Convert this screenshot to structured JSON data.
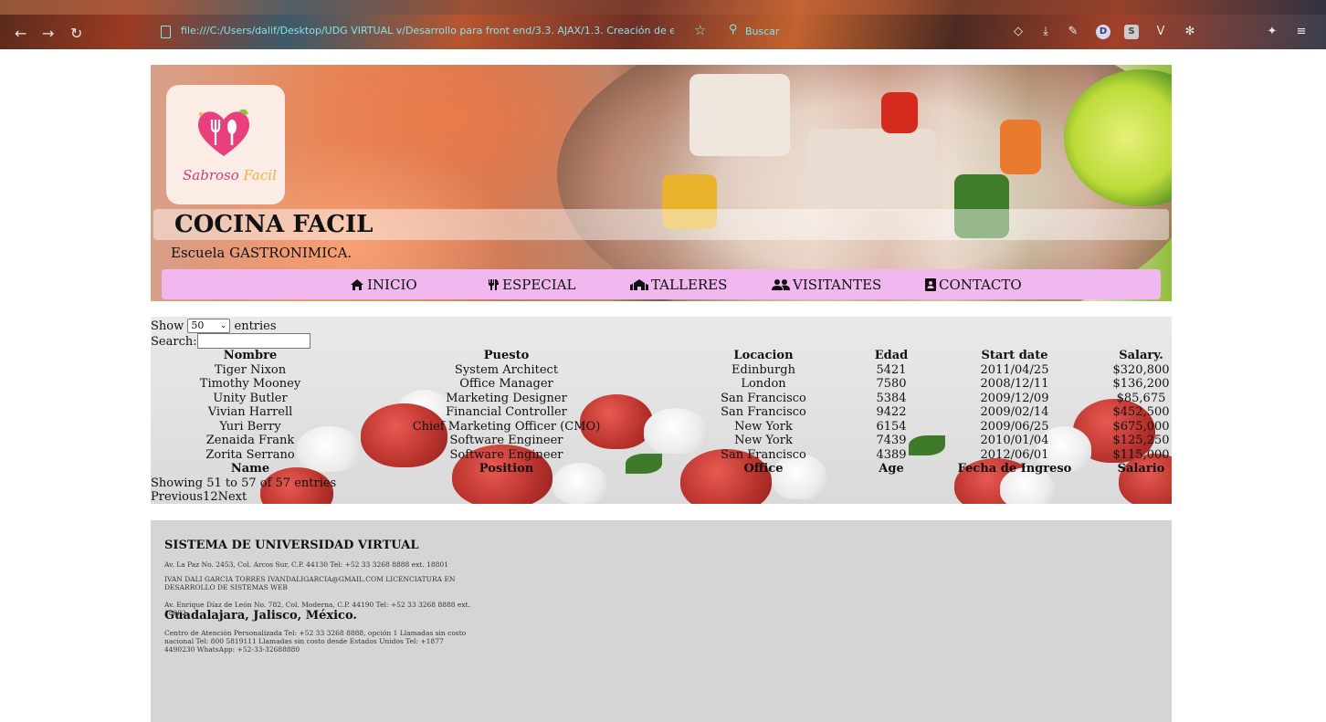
{
  "browser": {
    "url": "file:///C:/Users/dalif/Desktop/UDG VIRTUAL v/Desarrollo para front end/3.3. AJAX/1.3. Creación de elemen",
    "search_placeholder": "Buscar",
    "toolbar_icons": [
      "pocket-icon",
      "download-icon",
      "wrench-icon",
      "extension-d-icon",
      "extension-s-icon",
      "extension-v-icon",
      "extension-gear-icon",
      "extensions-icon",
      "menu-icon"
    ]
  },
  "banner": {
    "logo_text_1": "Sabroso",
    "logo_text_2": "Facil",
    "title": "COCINA FACIL",
    "subtitle": "Escuela GASTRONIMICA.",
    "nav": [
      {
        "label": "INICIO",
        "icon": "home-icon"
      },
      {
        "label": "ESPECIAL",
        "icon": "utensils-icon"
      },
      {
        "label": "TALLERES",
        "icon": "school-icon"
      },
      {
        "label": "VISITANTES",
        "icon": "users-icon"
      },
      {
        "label": "CONTACTO",
        "icon": "contact-book-icon"
      }
    ]
  },
  "table": {
    "show_label": "Show",
    "entries_value": "50",
    "entries_label": "entries",
    "search_label": "Search:",
    "headers": [
      "Nombre",
      "Puesto",
      "Locacion",
      "Edad",
      "Start date",
      "Salary."
    ],
    "rows": [
      [
        "Tiger Nixon",
        "System Architect",
        "Edinburgh",
        "5421",
        "2011/04/25",
        "$320,800"
      ],
      [
        "Timothy Mooney",
        "Office Manager",
        "London",
        "7580",
        "2008/12/11",
        "$136,200"
      ],
      [
        "Unity Butler",
        "Marketing Designer",
        "San Francisco",
        "5384",
        "2009/12/09",
        "$85,675"
      ],
      [
        "Vivian Harrell",
        "Financial Controller",
        "San Francisco",
        "9422",
        "2009/02/14",
        "$452,500"
      ],
      [
        "Yuri Berry",
        "Chief Marketing Officer (CMO)",
        "New York",
        "6154",
        "2009/06/25",
        "$675,000"
      ],
      [
        "Zenaida Frank",
        "Software Engineer",
        "New York",
        "7439",
        "2010/01/04",
        "$125,250"
      ],
      [
        "Zorita Serrano",
        "Software Engineer",
        "San Francisco",
        "4389",
        "2012/06/01",
        "$115,000"
      ]
    ],
    "footers": [
      "Name",
      "Position",
      "Office",
      "Age",
      "Fecha de Ingreso",
      "Salario"
    ],
    "info": "Showing 51 to 57 of 57 entries",
    "pager": {
      "previous": "Previous",
      "page1": "1",
      "page2": "2",
      "next": "Next"
    }
  },
  "footer": {
    "title": "SISTEMA DE UNIVERSIDAD VIRTUAL",
    "address1": "Av. La Paz No. 2453, Col. Arcos Sur, C.P. 44130 Tel: +52 33 3268 8888 ext. 18801",
    "author": "IVAN DALI GARCIA TORRES IVANDALIGARCIA@GMAIL.COM LICENCIATURA EN DESARROLLO DE SISTEMAS WEB",
    "address2": "Av. Enrique Díaz de León No. 782, Col. Moderna, C.P. 44190 Tel: +52 33 3268 8888 ext. 18802.",
    "city": "Guadalajara, Jalisco, México.",
    "contact": "Centro de Atención Personalizada Tel: +52 33 3268 8888, opción 1 Llamadas sin costo nacional Tel: 800 5819111 Llamadas sin costo desde Estados Unidos Tel: +1877 4490230 WhatsApp: +52-33-32688880"
  }
}
